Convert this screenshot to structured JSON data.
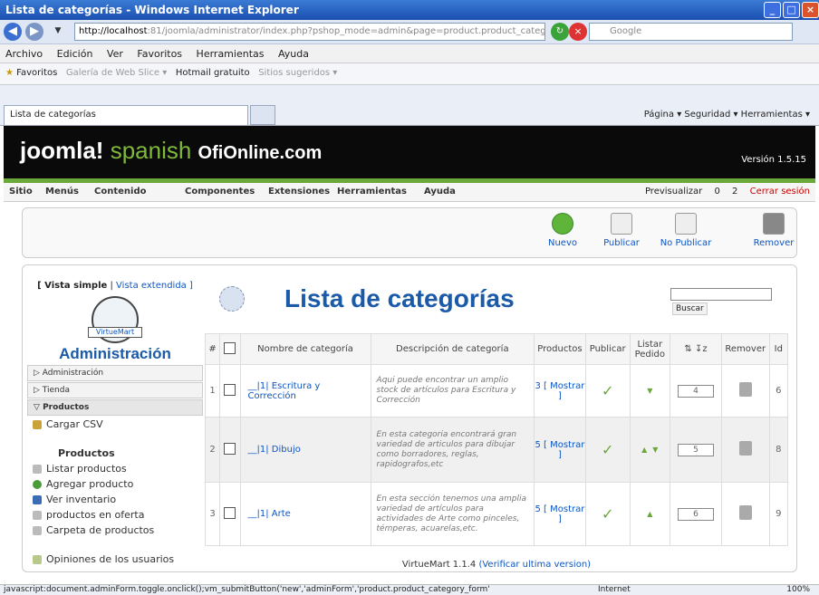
{
  "window": {
    "title": "Lista de categorías - Windows Internet Explorer"
  },
  "address": {
    "url_host": "http://localhost",
    "url_rest": ":81/joomla/administrator/index.php?pshop_mode=admin&page=product.product_category_list&",
    "search_placeholder": "Google"
  },
  "menubar": [
    "Archivo",
    "Edición",
    "Ver",
    "Favoritos",
    "Herramientas",
    "Ayuda"
  ],
  "favorites": {
    "label": "Favoritos",
    "items": [
      "Galería de Web Slice ▾",
      "Hotmail gratuito",
      "Sitios sugeridos ▾"
    ]
  },
  "tab": {
    "title": "Lista de categorías"
  },
  "commandbar": "Página ▾   Seguridad ▾   Herramientas ▾",
  "joomla": {
    "logo_main": "joomla!",
    "logo_lang": "spanish",
    "logo_site": "OfiOnline.com",
    "version": "Versión 1.5.15",
    "menu": [
      "Sitio",
      "Menús",
      "Contenido",
      "Componentes",
      "Extensiones",
      "Herramientas",
      "Ayuda"
    ],
    "preview": "Previsualizar",
    "msgs": "0",
    "users": "2",
    "logout": "Cerrar sesión"
  },
  "toolbar": {
    "new": "Nuevo",
    "publish": "Publicar",
    "unpublish": "No Publicar",
    "remove": "Remover"
  },
  "sidebar": {
    "simple": "[ Vista simple",
    "extended": "Vista extendida ]",
    "logo_text": "VirtueMart",
    "heading": "Administración",
    "sections": [
      "Administración",
      "Tienda",
      "Productos"
    ],
    "csv": "Cargar CSV",
    "products_heading": "Productos",
    "items": [
      "Listar productos",
      "Agregar producto",
      "Ver inventario",
      "productos en oferta",
      "Carpeta de productos"
    ],
    "reviews": "Opiniones de los usuarios"
  },
  "main": {
    "title": "Lista de categorías",
    "search_button": "Buscar",
    "columns": [
      "#",
      "",
      "Nombre de categoría",
      "Descripción de categoría",
      "Productos",
      "Publicar",
      "Listar Pedido",
      "",
      "Remover",
      "Id"
    ],
    "rows": [
      {
        "num": "1",
        "name": "__|1| Escritura y Corrección",
        "desc": "Aqui puede  encontrar un amplio stock de artículos para Escritura y Corrección",
        "products": "3 [ Mostrar ]",
        "order": "4",
        "id": "6"
      },
      {
        "num": "2",
        "name": "__|1| Dibujo",
        "desc": "En esta categoria encontrará gran variedad de articulos para dibujar como borradores, reglas, rapidografos,etc",
        "products": "5 [ Mostrar ]",
        "order": "5",
        "id": "8"
      },
      {
        "num": "3",
        "name": "__|1| Arte",
        "desc": "En esta sección tenemos una amplia variedad de artículos para actividades de Arte como pinceles, témperas, acuarelas,etc.",
        "products": "5 [ Mostrar ]",
        "order": "6",
        "id": "9"
      }
    ],
    "footer": "VirtueMart 1.1.4",
    "footer_link": "(Verificar ultima version)"
  },
  "status": {
    "text": "javascript:document.adminForm.toggle.onclick();vm_submitButton('new','adminForm','product.product_category_form'",
    "zone": "Internet",
    "zoom": "100%"
  }
}
